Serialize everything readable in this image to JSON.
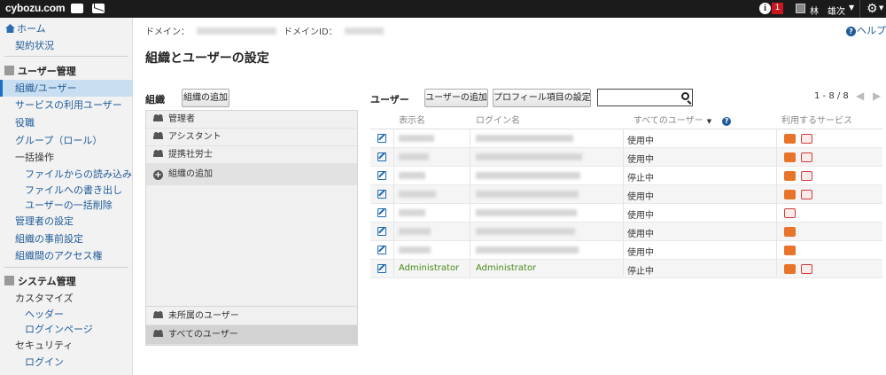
{
  "topbar": {
    "logo": "cybozu.com",
    "notification_count": "1",
    "info_glyph": "i",
    "user_name": "林　雄次",
    "icons": [
      "bird-icon",
      "mail-icon",
      "info-icon",
      "user-icon",
      "gear-icon"
    ]
  },
  "sidebar": {
    "home": "ホーム",
    "contract": "契約状況",
    "user_mgmt_head": "ユーザー管理",
    "items": [
      {
        "label": "組織/ユーザー",
        "active": true
      },
      {
        "label": "サービスの利用ユーザー"
      },
      {
        "label": "役職"
      },
      {
        "label": "グループ（ロール）"
      },
      {
        "label": "一括操作"
      },
      {
        "label": "ファイルからの読み込み"
      },
      {
        "label": "ファイルへの書き出し"
      },
      {
        "label": "ユーザーの一括削除"
      },
      {
        "label": "管理者の設定"
      },
      {
        "label": "組織の事前設定"
      },
      {
        "label": "組織間のアクセス権"
      }
    ],
    "system_mgmt_head": "システム管理",
    "system_items": [
      {
        "label": "カスタマイズ"
      },
      {
        "label": "ヘッダー"
      },
      {
        "label": "ログインページ"
      },
      {
        "label": "セキュリティ"
      },
      {
        "label": "ログイン"
      }
    ]
  },
  "header": {
    "domain_label": "ドメイン：",
    "domain_id_label": "ドメインID：",
    "help": "ヘルプ",
    "page_title": "組織とユーザーの設定"
  },
  "org": {
    "label": "組織",
    "add_button": "組織の追加",
    "items": [
      "管理者",
      "アシスタント",
      "提携社労士"
    ],
    "add_row": "組織の追加",
    "unassigned": "未所属のユーザー",
    "all_users": "すべてのユーザー"
  },
  "users": {
    "label": "ユーザー",
    "add_button": "ユーザーの追加",
    "profile_button": "プロフィール項目の設定",
    "search_placeholder": "",
    "pager": "1 - 8 / 8",
    "columns": {
      "display_name": "表示名",
      "login_name": "ログイン名",
      "filter": "すべてのユーザー",
      "services": "利用するサービス"
    },
    "rows": [
      {
        "display": "",
        "login": "",
        "status": "使用中",
        "services": [
          "garoon",
          "mail"
        ]
      },
      {
        "display": "",
        "login": "",
        "status": "使用中",
        "services": [
          "garoon",
          "mail"
        ]
      },
      {
        "display": "",
        "login": "",
        "status": "停止中",
        "services": [
          "garoon",
          "mail"
        ]
      },
      {
        "display": "",
        "login": "",
        "status": "使用中",
        "services": [
          "garoon",
          "mail"
        ]
      },
      {
        "display": "",
        "login": "",
        "status": "使用中",
        "services": [
          "mail"
        ]
      },
      {
        "display": "",
        "login": "",
        "status": "使用中",
        "services": [
          "garoon"
        ]
      },
      {
        "display": "",
        "login": "",
        "status": "使用中",
        "services": [
          "garoon"
        ]
      },
      {
        "display": "Administrator",
        "login": "Administrator",
        "status": "停止中",
        "services": [
          "garoon",
          "mail"
        ]
      }
    ]
  },
  "colors": {
    "accent": "#1f5b99",
    "service_orange": "#e8732a",
    "service_red": "#d23b3b",
    "badge_red": "#c8171e"
  }
}
